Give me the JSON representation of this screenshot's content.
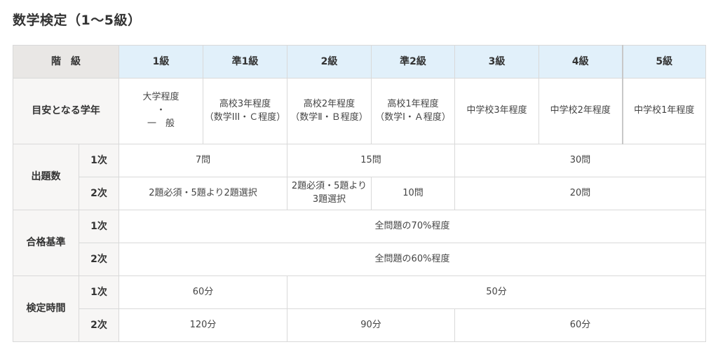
{
  "page_title": "数学検定（1〜5級）",
  "table": {
    "header_label": "階　級",
    "grades": [
      "1級",
      "準1級",
      "2級",
      "準2級",
      "3級",
      "4級",
      "5級"
    ],
    "target_label": "目安となる学年",
    "target": [
      [
        "大学程度",
        "・",
        "一　般"
      ],
      [
        "高校3年程度",
        "（数学III・Ｃ程度）"
      ],
      [
        "高校2年程度",
        "（数学Ⅱ・Ｂ程度）"
      ],
      [
        "高校1年程度",
        "（数学Ⅰ・Ａ程度）"
      ],
      [
        "中学校3年程度"
      ],
      [
        "中学校2年程度"
      ],
      [
        "中学校1年程度"
      ]
    ],
    "questions": {
      "label": "出題数",
      "first_label": "1次",
      "first": [
        "7問",
        "15問",
        "30問"
      ],
      "second_label": "2次",
      "second": [
        "2題必須・5題より2題選択",
        "2題必須・5題より",
        "3題選択",
        "10問",
        "20問"
      ]
    },
    "pass": {
      "label": "合格基準",
      "first_label": "1次",
      "first": "全問題の70%程度",
      "second_label": "2次",
      "second": "全問題の60%程度"
    },
    "time": {
      "label": "検定時間",
      "first_label": "1次",
      "first": [
        "60分",
        "50分"
      ],
      "second_label": "2次",
      "second": [
        "120分",
        "90分",
        "60分"
      ]
    }
  }
}
